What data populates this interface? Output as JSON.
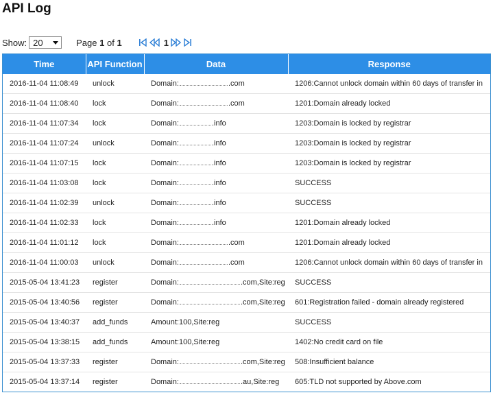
{
  "page": {
    "title": "API Log"
  },
  "controls": {
    "show_label": "Show:",
    "page_size": "20",
    "page_prefix": "Page",
    "page_current": "1",
    "page_of": "of",
    "page_total": "1",
    "nav_current": "1"
  },
  "colors": {
    "header_bg": "#2d8ee6",
    "border": "#3a8fd0"
  },
  "table": {
    "headers": {
      "time": "Time",
      "function": "API Function",
      "data": "Data",
      "response": "Response"
    },
    "rows": [
      {
        "time": "2016-11-04 11:08:49",
        "function": "unlock",
        "data_prefix": "Domain:",
        "data_suffix": ".com",
        "response": "1206:Cannot unlock domain within 60 days of transfer in"
      },
      {
        "time": "2016-11-04 11:08:40",
        "function": "lock",
        "data_prefix": "Domain:",
        "data_suffix": ".com",
        "response": "1201:Domain already locked"
      },
      {
        "time": "2016-11-04 11:07:34",
        "function": "lock",
        "data_prefix": "Domain:",
        "data_suffix": ".info",
        "response": "1203:Domain is locked by registrar"
      },
      {
        "time": "2016-11-04 11:07:24",
        "function": "unlock",
        "data_prefix": "Domain:",
        "data_suffix": ".info",
        "response": "1203:Domain is locked by registrar"
      },
      {
        "time": "2016-11-04 11:07:15",
        "function": "lock",
        "data_prefix": "Domain:",
        "data_suffix": ".info",
        "response": "1203:Domain is locked by registrar"
      },
      {
        "time": "2016-11-04 11:03:08",
        "function": "lock",
        "data_prefix": "Domain:",
        "data_suffix": ".info",
        "response": "SUCCESS"
      },
      {
        "time": "2016-11-04 11:02:39",
        "function": "unlock",
        "data_prefix": "Domain:",
        "data_suffix": ".info",
        "response": "SUCCESS"
      },
      {
        "time": "2016-11-04 11:02:33",
        "function": "lock",
        "data_prefix": "Domain:",
        "data_suffix": ".info",
        "response": "1201:Domain already locked"
      },
      {
        "time": "2016-11-04 11:01:12",
        "function": "lock",
        "data_prefix": "Domain:",
        "data_suffix": ".com",
        "response": "1201:Domain already locked"
      },
      {
        "time": "2016-11-04 11:00:03",
        "function": "unlock",
        "data_prefix": "Domain:",
        "data_suffix": ".com",
        "response": "1206:Cannot unlock domain within 60 days of transfer in"
      },
      {
        "time": "2015-05-04 13:41:23",
        "function": "register",
        "data_prefix": "Domain:",
        "data_suffix": ".com,Site:reg",
        "response": "SUCCESS"
      },
      {
        "time": "2015-05-04 13:40:56",
        "function": "register",
        "data_prefix": "Domain:",
        "data_suffix": ".com,Site:reg",
        "response": "601:Registration failed - domain already registered"
      },
      {
        "time": "2015-05-04 13:40:37",
        "function": "add_funds",
        "data_prefix": "Amount:100,Site:reg",
        "data_suffix": "",
        "response": "SUCCESS"
      },
      {
        "time": "2015-05-04 13:38:15",
        "function": "add_funds",
        "data_prefix": "Amount:100,Site:reg",
        "data_suffix": "",
        "response": "1402:No credit card on file"
      },
      {
        "time": "2015-05-04 13:37:33",
        "function": "register",
        "data_prefix": "Domain:",
        "data_suffix": ".com,Site:reg",
        "response": "508:Insufficient balance"
      },
      {
        "time": "2015-05-04 13:37:14",
        "function": "register",
        "data_prefix": "Domain:",
        "data_suffix": ".au,Site:reg",
        "response": "605:TLD not supported by Above.com"
      }
    ]
  }
}
